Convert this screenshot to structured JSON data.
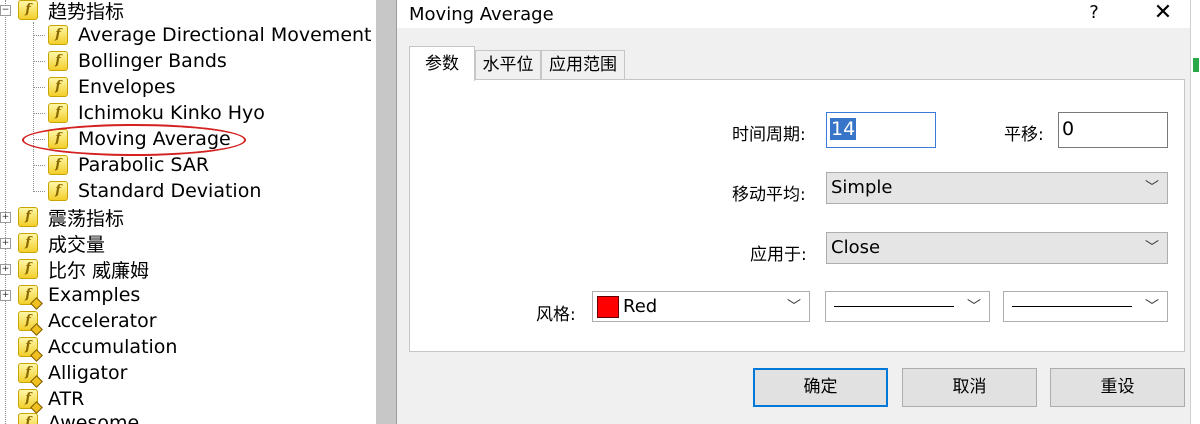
{
  "navigator": {
    "trend_group": "趋势指标",
    "trend_items": [
      "Average Directional Movement Index",
      "Bollinger Bands",
      "Envelopes",
      "Ichimoku Kinko Hyo",
      "Moving Average",
      "Parabolic SAR",
      "Standard Deviation"
    ],
    "groups": [
      "震荡指标",
      "成交量",
      "比尔 威廉姆"
    ],
    "custom_items": [
      "Examples",
      "Accelerator",
      "Accumulation",
      "Alligator",
      "ATR",
      "Awesome"
    ],
    "highlight_color": "#d42020"
  },
  "dialog": {
    "title": "Moving Average",
    "help_label": "?",
    "close_label": "✕",
    "tabs": [
      "参数",
      "水平位",
      "应用范围"
    ],
    "active_tab": "参数",
    "fields": {
      "period_label": "时间周期:",
      "period_value": "14",
      "shift_label": "平移:",
      "shift_value": "0",
      "method_label": "移动平均:",
      "method_value": "Simple",
      "apply_label": "应用于:",
      "apply_value": "Close",
      "style_label": "风格:",
      "color_value": "Red",
      "color_hex": "#ff0000"
    },
    "buttons": {
      "ok": "确定",
      "cancel": "取消",
      "reset": "重设"
    }
  }
}
